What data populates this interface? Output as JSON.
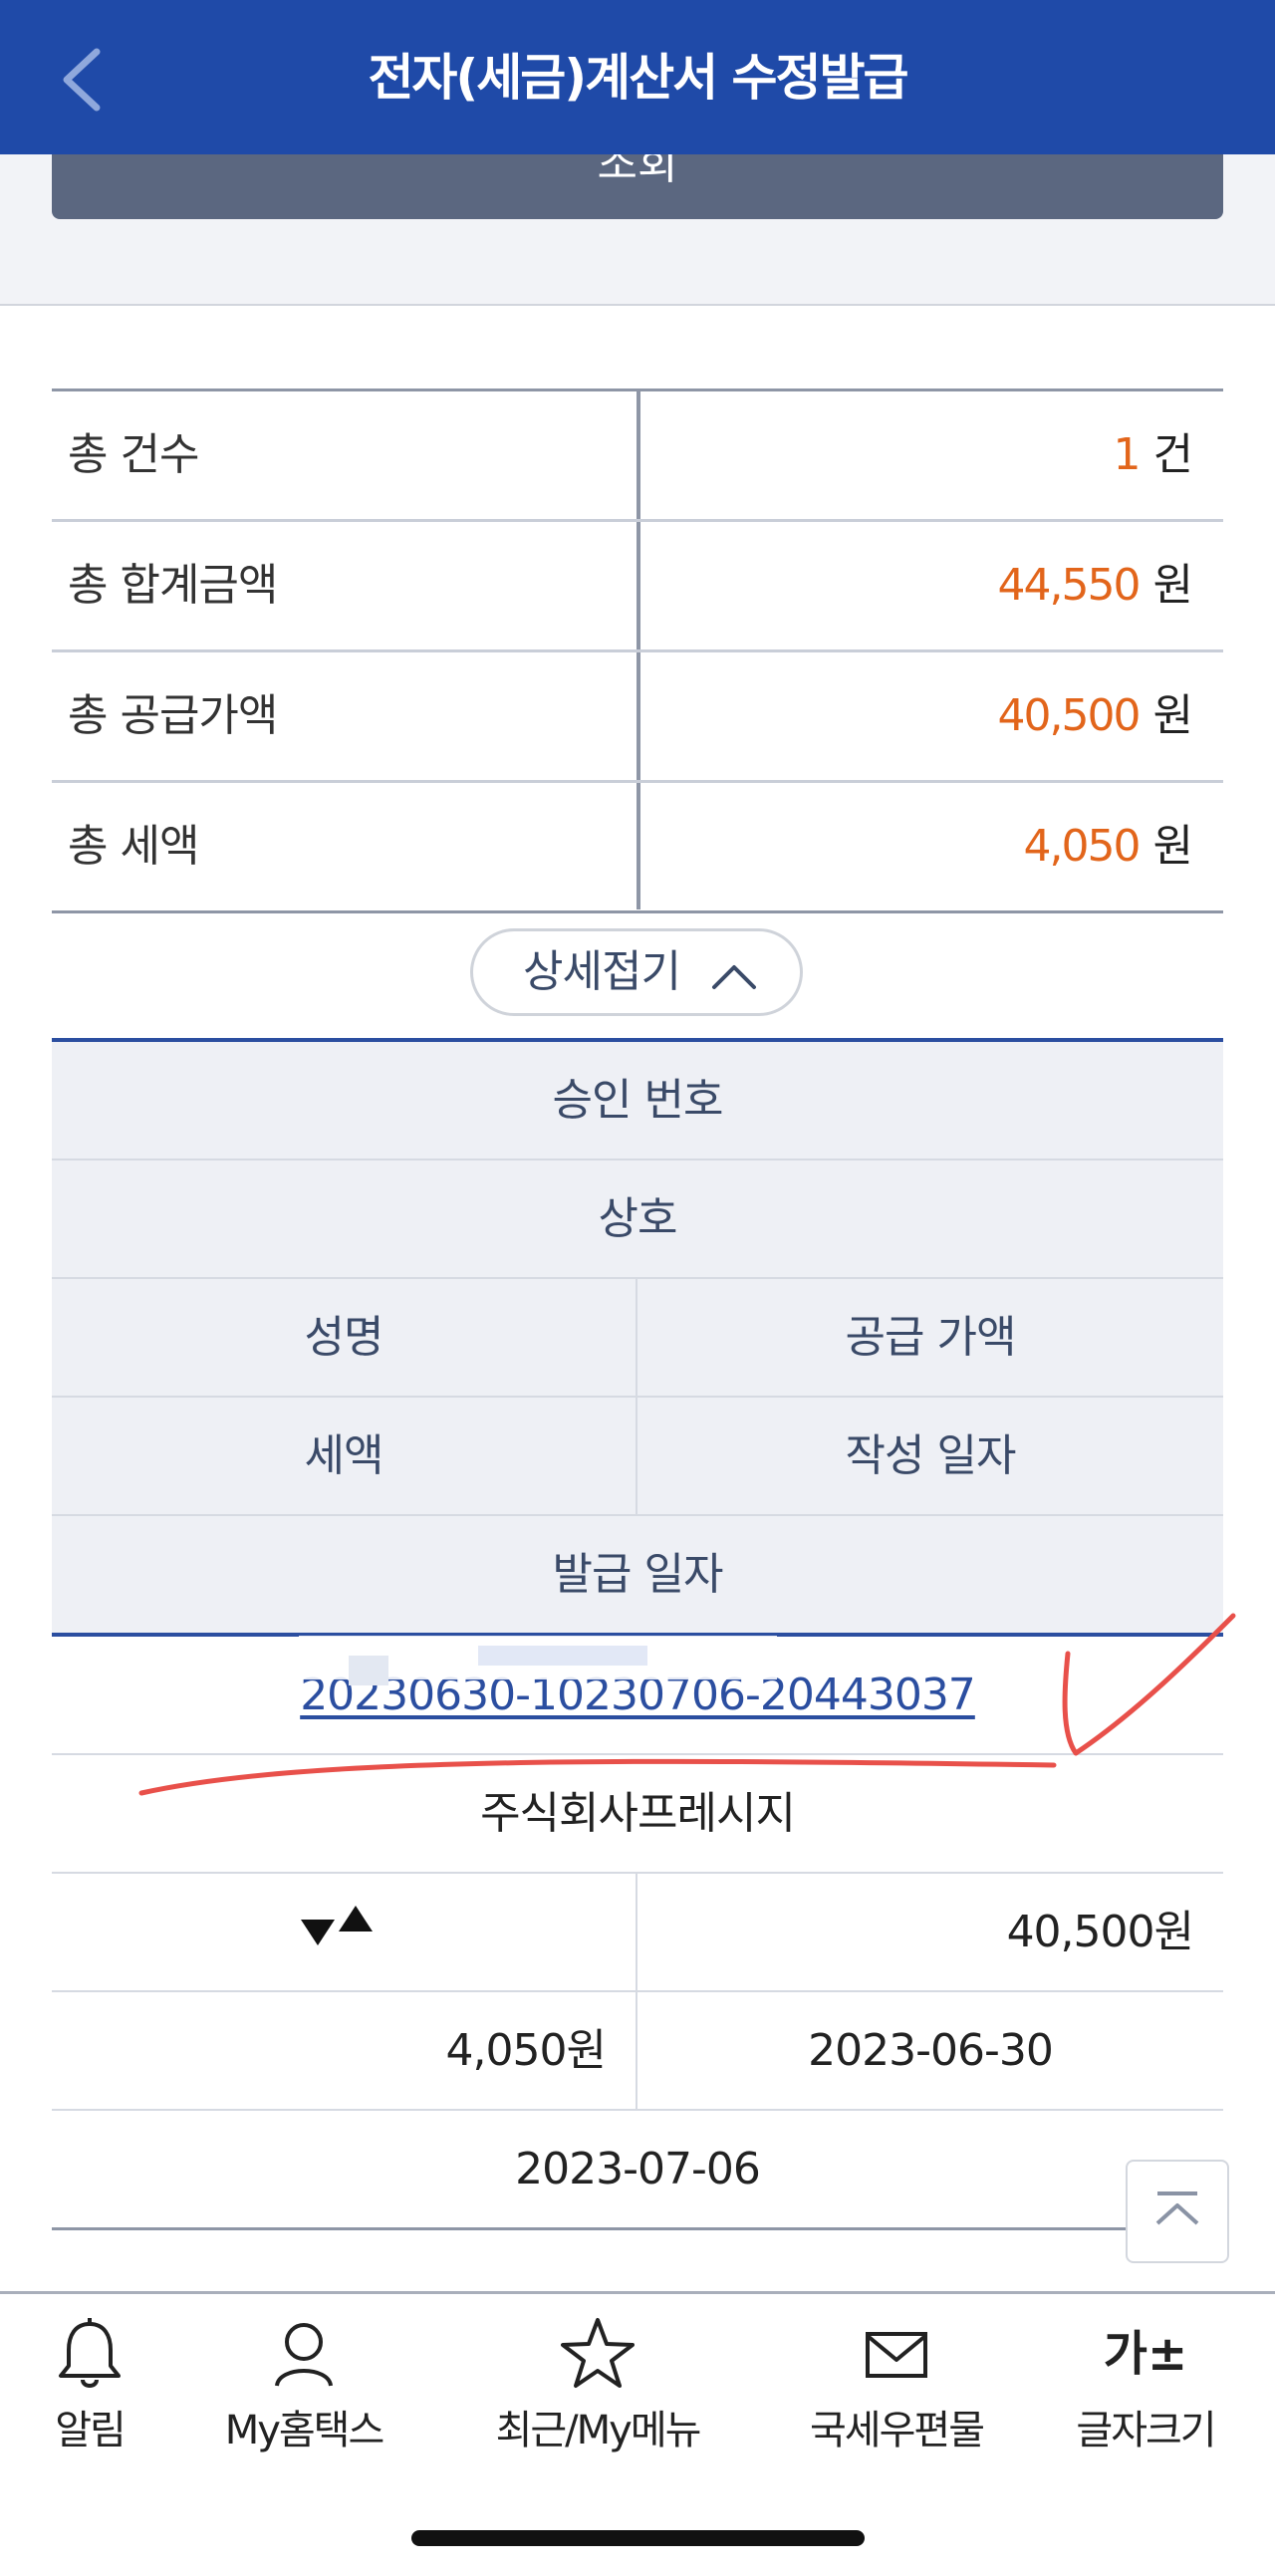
{
  "header": {
    "title": "전자(세금)계산서 수정발급"
  },
  "search": {
    "button_label": "조회"
  },
  "summary": {
    "rows": [
      {
        "label": "총 건수",
        "value": "1",
        "unit": "건"
      },
      {
        "label": "총 합계금액",
        "value": "44,550",
        "unit": "원"
      },
      {
        "label": "총 공급가액",
        "value": "40,500",
        "unit": "원"
      },
      {
        "label": "총 세액",
        "value": "4,050",
        "unit": "원"
      }
    ]
  },
  "collapse": {
    "label": "상세접기"
  },
  "detail": {
    "headers": {
      "approval_no": "승인 번호",
      "company": "상호",
      "name": "성명",
      "supply_amount": "공급 가액",
      "tax": "세액",
      "write_date": "작성 일자",
      "issue_date": "발급 일자"
    },
    "record": {
      "approval_no": "20230630-10230706-20443037",
      "company": "주식회사프레시지",
      "name": "",
      "supply_amount": "40,500원",
      "tax": "4,050원",
      "write_date": "2023-06-30",
      "issue_date": "2023-07-06"
    }
  },
  "bottom_nav": [
    {
      "label": "알림",
      "icon": "bell-icon"
    },
    {
      "label": "My홈택스",
      "icon": "user-icon"
    },
    {
      "label": "최근/My메뉴",
      "icon": "star-icon"
    },
    {
      "label": "국세우편물",
      "icon": "mail-icon"
    },
    {
      "label": "글자크기",
      "icon": "font-size-icon",
      "glyph": "가±"
    }
  ],
  "colors": {
    "header": "#1f4aa8",
    "accent_orange": "#e2651b",
    "link": "#2b4ea0",
    "annotation": "#e8504a"
  }
}
